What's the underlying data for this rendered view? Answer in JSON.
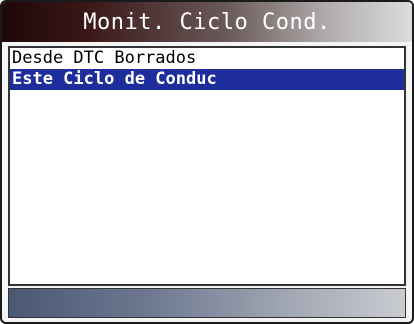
{
  "header": {
    "title": "Monit. Ciclo Cond."
  },
  "menu": {
    "items": [
      {
        "label": "Desde DTC Borrados",
        "selected": false
      },
      {
        "label": "Este Ciclo de Conduc",
        "selected": true
      }
    ]
  },
  "colors": {
    "selection_bg": "#1e2d9c",
    "selection_text": "#ffffff",
    "title_text": "#ffffff"
  }
}
